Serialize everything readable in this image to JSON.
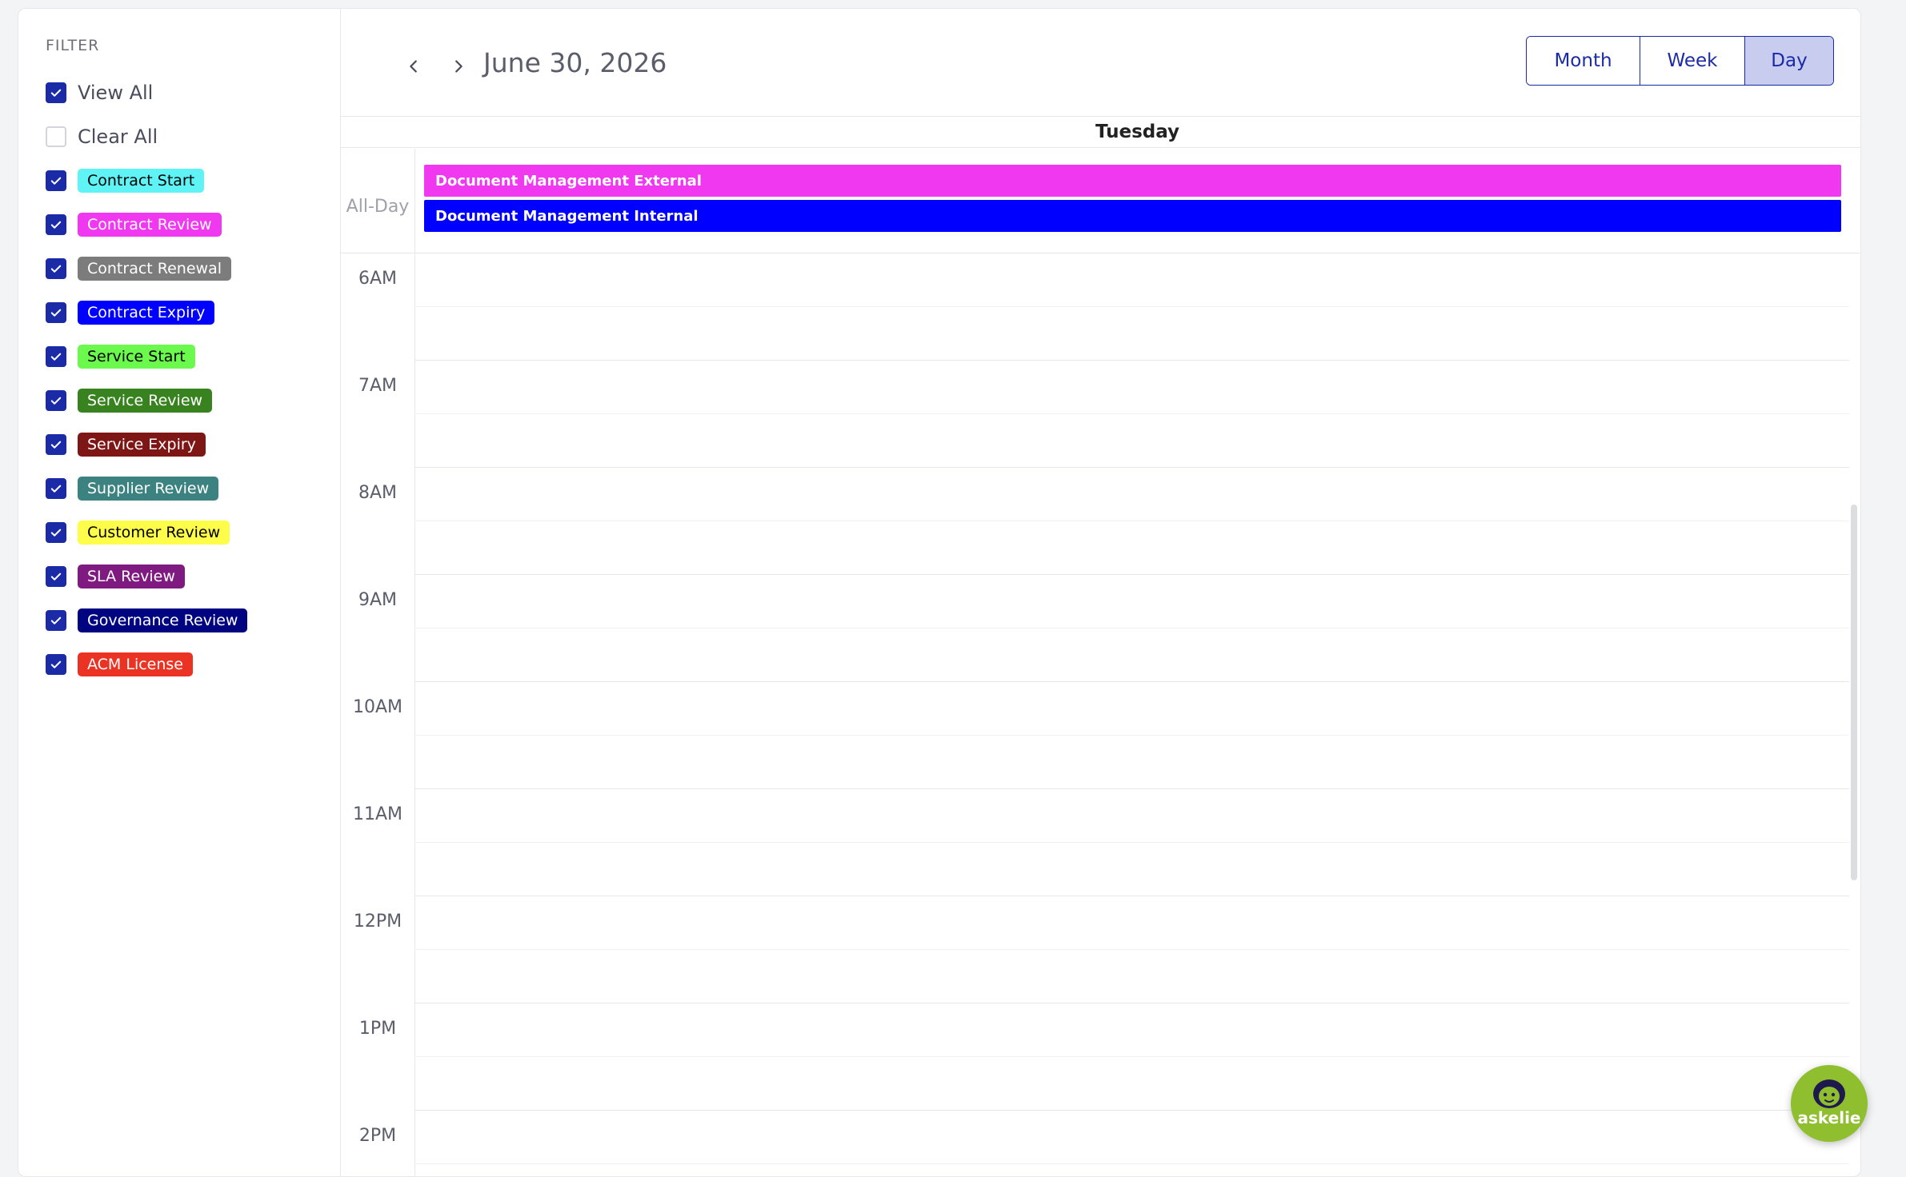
{
  "sidebar": {
    "title": "FILTER",
    "view_all": {
      "label": "View All",
      "checked": true
    },
    "clear_all": {
      "label": "Clear All",
      "checked": false
    },
    "filters": [
      {
        "label": "Contract Start",
        "bg": "#5ff3f6",
        "fg": "#000000",
        "checked": true
      },
      {
        "label": "Contract Review",
        "bg": "#ef38f0",
        "fg": "#ffffff",
        "checked": true
      },
      {
        "label": "Contract Renewal",
        "bg": "#7c7c7c",
        "fg": "#ffffff",
        "checked": true
      },
      {
        "label": "Contract Expiry",
        "bg": "#0000ff",
        "fg": "#ffffff",
        "checked": true
      },
      {
        "label": "Service Start",
        "bg": "#6cf94d",
        "fg": "#000000",
        "checked": true
      },
      {
        "label": "Service Review",
        "bg": "#38821f",
        "fg": "#ffffff",
        "checked": true
      },
      {
        "label": "Service Expiry",
        "bg": "#7f1616",
        "fg": "#ffffff",
        "checked": true
      },
      {
        "label": "Supplier Review",
        "bg": "#3c8280",
        "fg": "#ffffff",
        "checked": true
      },
      {
        "label": "Customer Review",
        "bg": "#fefe4a",
        "fg": "#000000",
        "checked": true
      },
      {
        "label": "SLA Review",
        "bg": "#7f1b80",
        "fg": "#ffffff",
        "checked": true
      },
      {
        "label": "Governance Review",
        "bg": "#010481",
        "fg": "#ffffff",
        "checked": true
      },
      {
        "label": "ACM License",
        "bg": "#ea3323",
        "fg": "#ffffff",
        "checked": true
      }
    ]
  },
  "header": {
    "prev_icon": "chevron-left-icon",
    "next_icon": "chevron-right-icon",
    "date_title": "June 30, 2026",
    "views": [
      {
        "label": "Month",
        "active": false
      },
      {
        "label": "Week",
        "active": false
      },
      {
        "label": "Day",
        "active": true
      }
    ]
  },
  "calendar": {
    "day_name": "Tuesday",
    "all_day_label": "All-Day",
    "all_day_events": [
      {
        "title": "Document Management External",
        "color": "#ef38f0"
      },
      {
        "title": "Document Management Internal",
        "color": "#0000ff"
      }
    ],
    "hours": [
      "6AM",
      "7AM",
      "8AM",
      "9AM",
      "10AM",
      "11AM",
      "12PM",
      "1PM",
      "2PM"
    ]
  },
  "assistant": {
    "label": "askelie",
    "icon": "assistant-avatar-icon"
  },
  "colors": {
    "accent": "#1b2aa6",
    "active_view_bg": "#c8ccef"
  }
}
